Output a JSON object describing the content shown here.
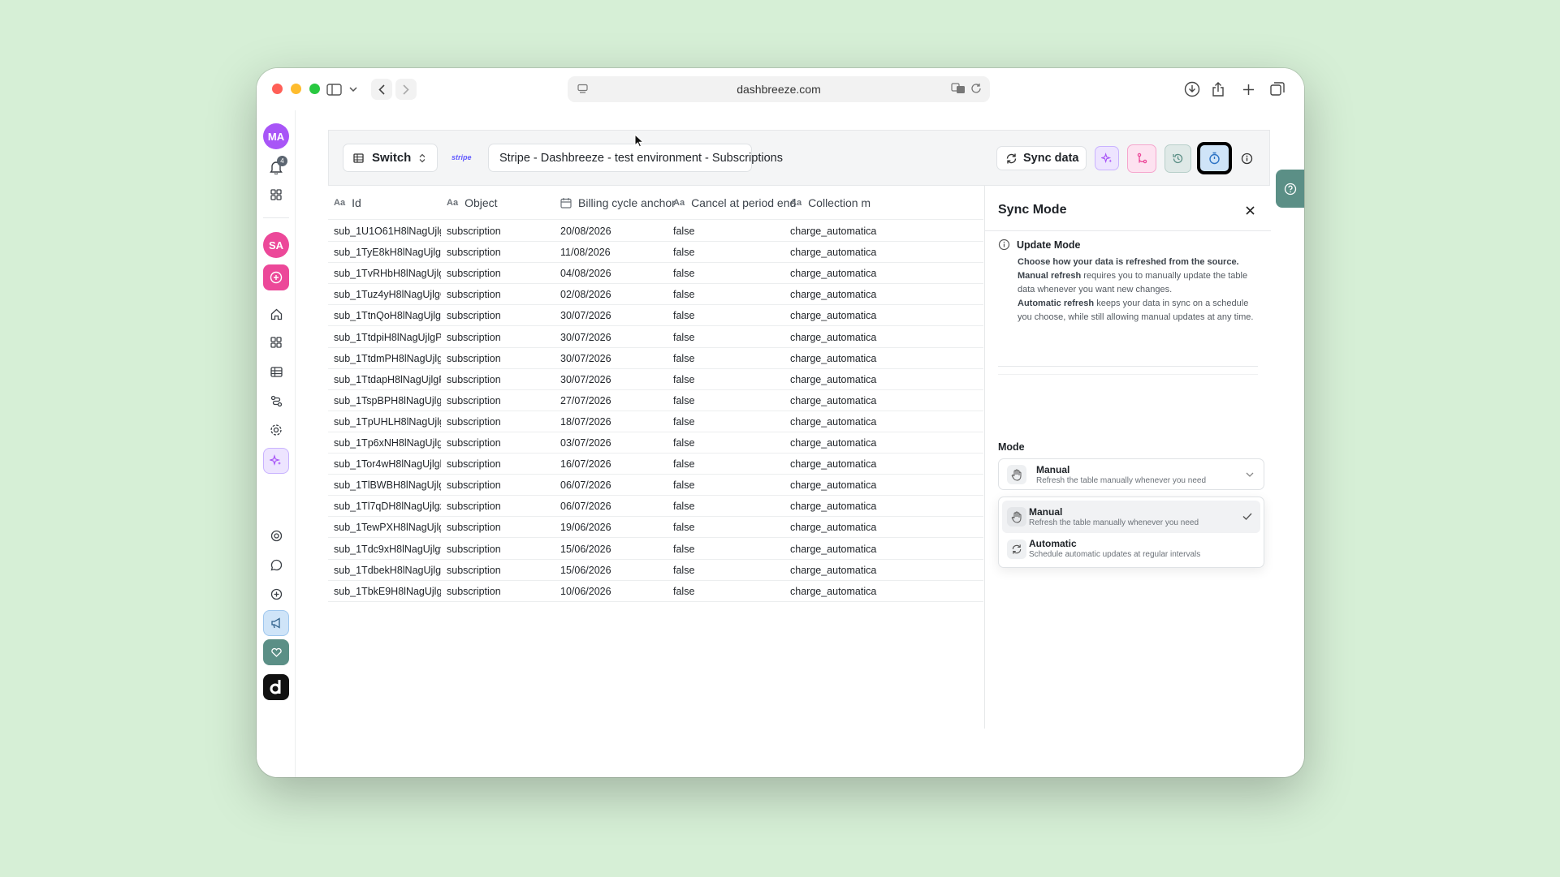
{
  "browser": {
    "url": "dashbreeze.com"
  },
  "rail": {
    "user_initials": "MA",
    "notification_count": "4",
    "workspace_initials": "SA"
  },
  "topbar": {
    "switch_label": "Switch",
    "stripe_logo": "stripe",
    "source_name": "Stripe - Dashbreeze - test environment  - Subscriptions",
    "sync_label": "Sync data"
  },
  "table": {
    "columns": [
      "Id",
      "Object",
      "Billing cycle anchor",
      "Cancel at period end",
      "Collection m"
    ],
    "rows": [
      {
        "id": "sub_1U1O61H8lNagUjlgf...",
        "object": "subscription",
        "anchor": "20/08/2026",
        "cancel": "false",
        "collection": "charge_automatica"
      },
      {
        "id": "sub_1TyE8kH8lNagUjlg1...",
        "object": "subscription",
        "anchor": "11/08/2026",
        "cancel": "false",
        "collection": "charge_automatica"
      },
      {
        "id": "sub_1TvRHbH8lNagUjlgl...",
        "object": "subscription",
        "anchor": "04/08/2026",
        "cancel": "false",
        "collection": "charge_automatica"
      },
      {
        "id": "sub_1Tuz4yH8lNagUjlgO...",
        "object": "subscription",
        "anchor": "02/08/2026",
        "cancel": "false",
        "collection": "charge_automatica"
      },
      {
        "id": "sub_1TtnQoH8lNagUjlgu...",
        "object": "subscription",
        "anchor": "30/07/2026",
        "cancel": "false",
        "collection": "charge_automatica"
      },
      {
        "id": "sub_1TtdpiH8lNagUjlgPd...",
        "object": "subscription",
        "anchor": "30/07/2026",
        "cancel": "false",
        "collection": "charge_automatica"
      },
      {
        "id": "sub_1TtdmPH8lNagUjlg0...",
        "object": "subscription",
        "anchor": "30/07/2026",
        "cancel": "false",
        "collection": "charge_automatica"
      },
      {
        "id": "sub_1TtdapH8lNagUjlgP9...",
        "object": "subscription",
        "anchor": "30/07/2026",
        "cancel": "false",
        "collection": "charge_automatica"
      },
      {
        "id": "sub_1TspBPH8lNagUjlg5...",
        "object": "subscription",
        "anchor": "27/07/2026",
        "cancel": "false",
        "collection": "charge_automatica"
      },
      {
        "id": "sub_1TpUHLH8lNagUjlg5...",
        "object": "subscription",
        "anchor": "18/07/2026",
        "cancel": "false",
        "collection": "charge_automatica"
      },
      {
        "id": "sub_1Tp6xNH8lNagUjlgy...",
        "object": "subscription",
        "anchor": "03/07/2026",
        "cancel": "false",
        "collection": "charge_automatica"
      },
      {
        "id": "sub_1Tor4wH8lNagUjlgb...",
        "object": "subscription",
        "anchor": "16/07/2026",
        "cancel": "false",
        "collection": "charge_automatica"
      },
      {
        "id": "sub_1TlBWBH8lNagUjlgA...",
        "object": "subscription",
        "anchor": "06/07/2026",
        "cancel": "false",
        "collection": "charge_automatica"
      },
      {
        "id": "sub_1Tl7qDH8lNagUjlgzY...",
        "object": "subscription",
        "anchor": "06/07/2026",
        "cancel": "false",
        "collection": "charge_automatica"
      },
      {
        "id": "sub_1TewPXH8lNagUjlgm...",
        "object": "subscription",
        "anchor": "19/06/2026",
        "cancel": "false",
        "collection": "charge_automatica"
      },
      {
        "id": "sub_1Tdc9xH8lNagUjlgw...",
        "object": "subscription",
        "anchor": "15/06/2026",
        "cancel": "false",
        "collection": "charge_automatica"
      },
      {
        "id": "sub_1TdbekH8lNagUjlgz...",
        "object": "subscription",
        "anchor": "15/06/2026",
        "cancel": "false",
        "collection": "charge_automatica"
      },
      {
        "id": "sub_1TbkE9H8lNagUjlgw...",
        "object": "subscription",
        "anchor": "10/06/2026",
        "cancel": "false",
        "collection": "charge_automatica"
      }
    ]
  },
  "sync_panel": {
    "title": "Sync Mode",
    "info_title": "Update Mode",
    "info_intro": "Choose how your data is refreshed from the source.",
    "manual_term": "Manual refresh",
    "manual_text": " requires you to manually update the table data whenever you want new changes.",
    "auto_term": "Automatic refresh",
    "auto_text": " keeps your data in sync on a schedule you choose, while still allowing manual updates at any time.",
    "mode_label": "Mode",
    "selected": {
      "title": "Manual",
      "desc": "Refresh the table manually whenever you need"
    },
    "options": [
      {
        "title": "Manual",
        "desc": "Refresh the table manually whenever you need",
        "icon": "hand-icon"
      },
      {
        "title": "Automatic",
        "desc": "Schedule automatic updates at regular intervals",
        "icon": "refresh-icon"
      }
    ]
  },
  "colors": {
    "background": "#d6efd6",
    "accent_purple": "#a855f7",
    "accent_pink": "#ec4899",
    "help_tab": "#5b8f86",
    "selected_tool": "#cfe4f8"
  }
}
